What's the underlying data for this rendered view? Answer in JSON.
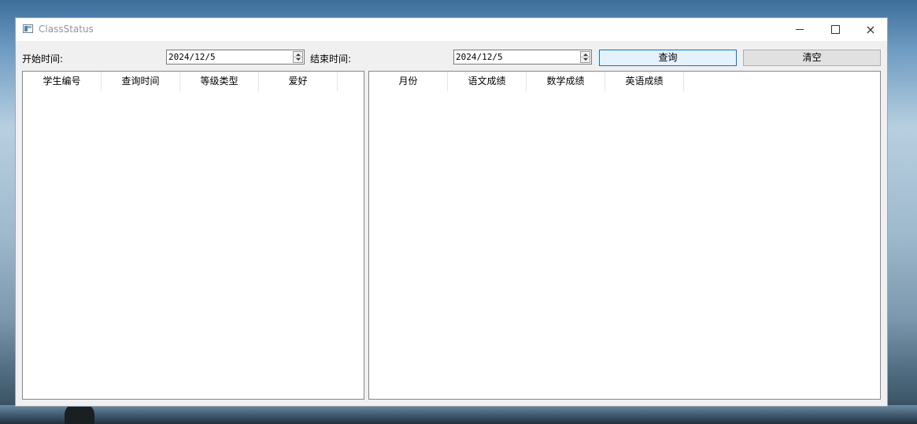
{
  "window": {
    "title": "ClassStatus",
    "controls": {
      "minimize": "–",
      "maximize": "□",
      "close": "×"
    }
  },
  "filters": {
    "start_label": "开始时间:",
    "start_value": "2024/12/5",
    "end_label": "结束时间:",
    "end_value": "2024/12/5"
  },
  "buttons": {
    "query": "查询",
    "clear": "清空"
  },
  "left_table": {
    "columns": [
      "学生编号",
      "查询时间",
      "等级类型",
      "爱好"
    ],
    "rows": []
  },
  "right_table": {
    "columns": [
      "月份",
      "语文成绩",
      "数学成绩",
      "英语成绩"
    ],
    "rows": []
  },
  "colors": {
    "query_button_bg": "#e5f1fb",
    "query_button_border": "#0078d7",
    "window_bg": "#f0f0f0"
  },
  "icons": [
    "app-icon",
    "minimize-icon",
    "maximize-icon",
    "close-icon",
    "spin-up-icon",
    "spin-down-icon"
  ]
}
